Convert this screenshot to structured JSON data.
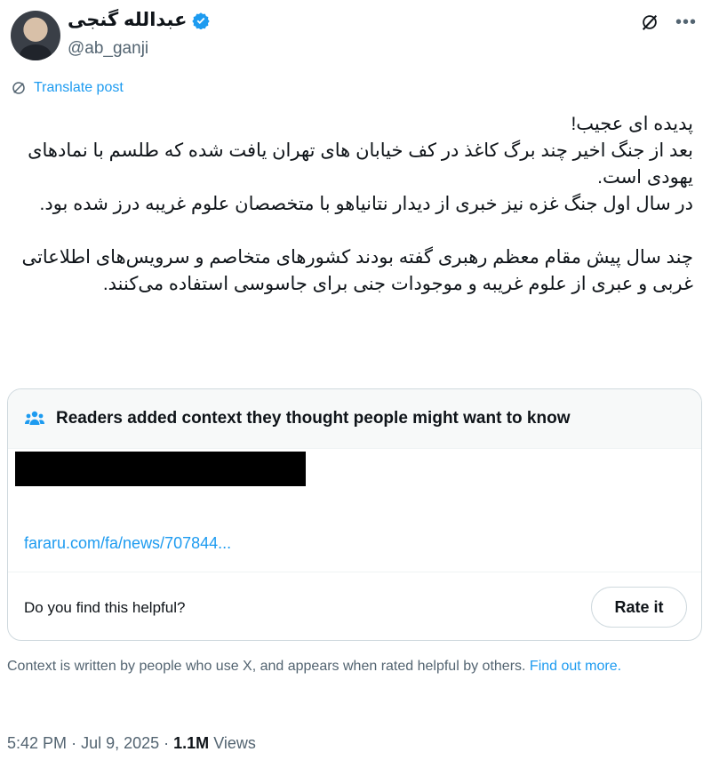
{
  "author": {
    "display_name": "عبدالله گنجی",
    "handle": "@ab_ganji"
  },
  "translate_label": "Translate post",
  "tweet_text": "پدیده ای عجیب!\nبعد از جنگ اخیر چند برگ کاغذ در کف خیابان های تهران یافت شده که طلسم با نمادهای یهودی است.\nدر سال اول جنگ غزه نیز خبری از دیدار نتانیاهو با متخصصان علوم غریبه درز شده بود.\n\nچند سال پیش مقام معظم رهبری گفته بودند کشورهای متخاصم و سرویس‌های اطلاعاتی غربی و عبری از علوم غریبه و موجودات جنی برای جاسوسی استفاده می‌کنند.",
  "community_note": {
    "title": "Readers added context they thought people might want to know",
    "link": "fararu.com/fa/news/707844...",
    "helpful_question": "Do you find this helpful?",
    "rate_button": "Rate it"
  },
  "context_footer": {
    "text": "Context is written by people who use X, and appears when rated helpful by others.",
    "link": "Find out more."
  },
  "meta": {
    "time": "5:42 PM",
    "date": "Jul 9, 2025",
    "views_count": "1.1M",
    "views_label": "Views"
  },
  "icons": {
    "verified": "verified-badge-icon",
    "grok": "grok-icon",
    "more": "more-icon",
    "translate": "globe-icon",
    "note": "people-icon"
  },
  "colors": {
    "accent": "#1d9bf0",
    "text": "#0f1419",
    "secondary": "#536471",
    "border": "#cfd9de"
  }
}
